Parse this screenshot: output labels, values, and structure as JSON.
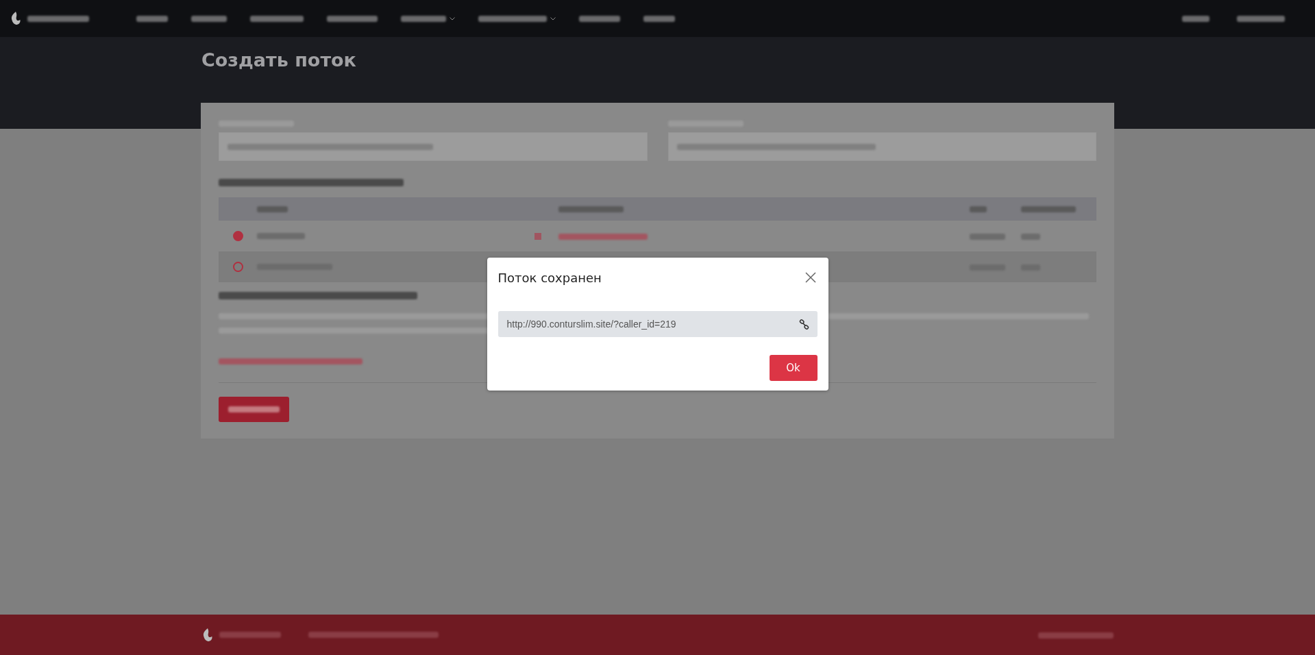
{
  "page": {
    "title": "Создать поток"
  },
  "form": {
    "landings": [
      {
        "selected": true
      },
      {
        "selected": false
      }
    ]
  },
  "modal": {
    "title": "Поток сохранен",
    "link": "http://990.conturslim.site/?caller_id=219",
    "ok_button": "Ok"
  }
}
